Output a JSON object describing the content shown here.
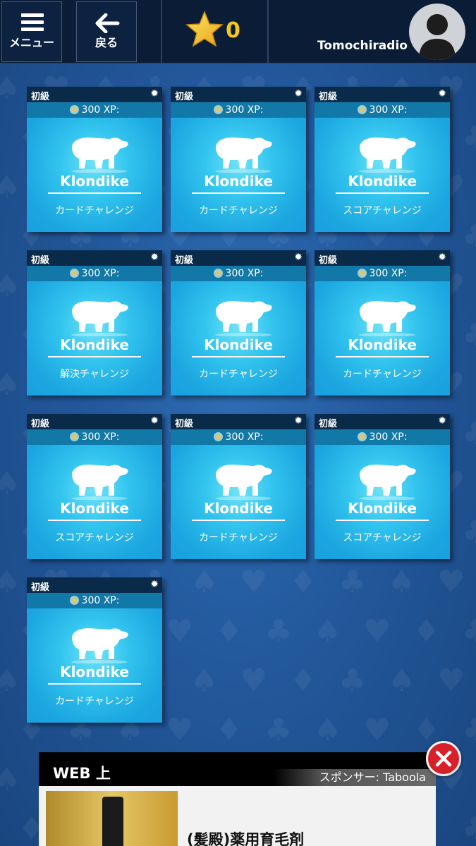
{
  "topbar": {
    "menu_label": "メニュー",
    "back_label": "戻る",
    "star_count": "0",
    "username": "Tomochiradio"
  },
  "colors": {
    "topbar": "#0b1d36",
    "background": "#1e4f8f",
    "tile": "#1a9fdf",
    "star": "#f7c81c",
    "close": "#d8202a"
  },
  "tiles": [
    {
      "level": "初級",
      "xp": "300 XP:",
      "game": "Klondike",
      "challenge": "カードチャレンジ"
    },
    {
      "level": "初級",
      "xp": "300 XP:",
      "game": "Klondike",
      "challenge": "カードチャレンジ"
    },
    {
      "level": "初級",
      "xp": "300 XP:",
      "game": "Klondike",
      "challenge": "スコアチャレンジ"
    },
    {
      "level": "初級",
      "xp": "300 XP:",
      "game": "Klondike",
      "challenge": "解決チャレンジ"
    },
    {
      "level": "初級",
      "xp": "300 XP:",
      "game": "Klondike",
      "challenge": "カードチャレンジ"
    },
    {
      "level": "初級",
      "xp": "300 XP:",
      "game": "Klondike",
      "challenge": "カードチャレンジ"
    },
    {
      "level": "初級",
      "xp": "300 XP:",
      "game": "Klondike",
      "challenge": "スコアチャレンジ"
    },
    {
      "level": "初級",
      "xp": "300 XP:",
      "game": "Klondike",
      "challenge": "カードチャレンジ"
    },
    {
      "level": "初級",
      "xp": "300 XP:",
      "game": "Klondike",
      "challenge": "スコアチャレンジ"
    },
    {
      "level": "初級",
      "xp": "300 XP:",
      "game": "Klondike",
      "challenge": "カードチャレンジ"
    }
  ],
  "ad": {
    "title": "WEB 上",
    "sponsor": "スポンサー: Taboola",
    "caption": "(髪殿)薬用育毛剤"
  }
}
